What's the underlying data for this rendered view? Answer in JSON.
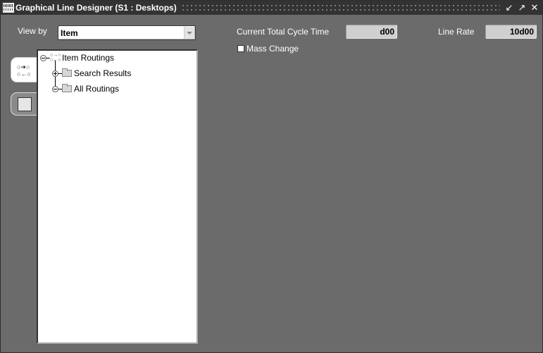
{
  "window": {
    "title": "Graphical Line Designer (S1 : Desktops)",
    "controls": {
      "minimize_icon": "minimize-icon",
      "maximize_icon": "maximize-icon",
      "close_icon": "close-icon"
    }
  },
  "view_by": {
    "label": "View by",
    "value": "Item"
  },
  "metrics": {
    "cycle_time_label": "Current Total Cycle Time",
    "cycle_time_value": "d00",
    "line_rate_label": "Line Rate",
    "line_rate_value": "10d00"
  },
  "mass_change": {
    "label": "Mass Change",
    "checked": false
  },
  "tabs": [
    {
      "name": "routing-tree-tab",
      "icon": "routing-flow-icon",
      "active": true
    },
    {
      "name": "graphical-view-tab",
      "icon": "graph-canvas-icon",
      "active": false
    }
  ],
  "tree": {
    "root": {
      "label": "Item Routings",
      "expanded": true,
      "icon": "routing-icon"
    },
    "children": [
      {
        "label": "Search Results",
        "expanded": false,
        "icon": "folder-icon"
      },
      {
        "label": "All Routings",
        "expanded": true,
        "icon": "folder-icon"
      }
    ]
  }
}
